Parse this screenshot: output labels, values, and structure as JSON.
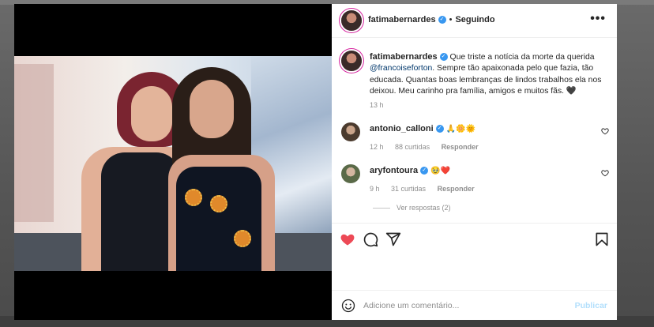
{
  "post": {
    "author": "fatimabernardes",
    "follow_status": "Seguindo",
    "more_label": "•••",
    "caption_text": "Que triste a notícia da morte da querida",
    "caption_mention": "@francoiseforton",
    "caption_rest": ". Sempre tão apaixonada pelo que fazia, tão educada. Quantas boas lembranças de lindos trabalhos ela nos deixou. Meu carinho pra família, amigos e muitos fãs. 🖤",
    "caption_time": "13 h"
  },
  "comments": [
    {
      "username": "antonio_calloni",
      "text": "🙏🌼🌞",
      "time": "12 h",
      "likes": "88 curtidas",
      "reply_label": "Responder"
    },
    {
      "username": "aryfontoura",
      "text": "🥹❤️",
      "time": "9 h",
      "likes": "31 curtidas",
      "reply_label": "Responder",
      "view_replies": "Ver respostas (2)"
    }
  ],
  "add_comment": {
    "placeholder": "Adicione um comentário...",
    "publish_label": "Publicar"
  },
  "icons": {
    "like": "heart-icon",
    "comment": "comment-icon",
    "share": "paper-plane-icon",
    "save": "bookmark-icon",
    "emoji": "smiley-icon"
  },
  "colors": {
    "like_red": "#ed4956",
    "verified_blue": "#3897f0",
    "mention_blue": "#00376b",
    "publish_disabled": "#b2dffc"
  }
}
